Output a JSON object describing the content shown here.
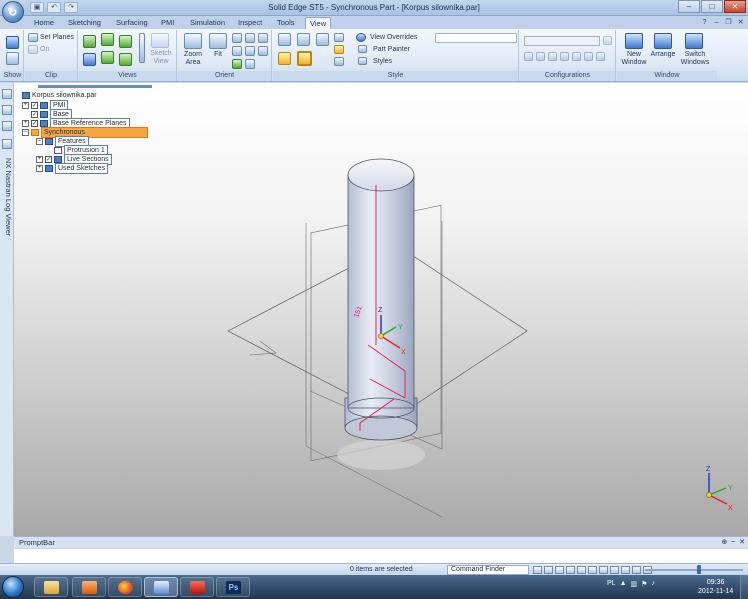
{
  "app": {
    "window_title": "Solid Edge ST5 - Synchronous Part - [Korpus silownika.par]",
    "quick_access": [
      "save-icon",
      "undo-icon",
      "redo-icon"
    ]
  },
  "tabs": [
    {
      "label": "Home",
      "active": false
    },
    {
      "label": "Sketching",
      "active": false
    },
    {
      "label": "Surfacing",
      "active": false
    },
    {
      "label": "PMI",
      "active": false
    },
    {
      "label": "Simulation",
      "active": false
    },
    {
      "label": "Inspect",
      "active": false
    },
    {
      "label": "Tools",
      "active": false
    },
    {
      "label": "View",
      "active": true
    }
  ],
  "ribbon": {
    "show": {
      "label": "Show"
    },
    "clip": {
      "label": "Clip",
      "set_planes": "Set Planes",
      "on": "On"
    },
    "views": {
      "label": "Views",
      "sketch_view": "Sketch\nView"
    },
    "orient": {
      "label": "Orient",
      "zoom_area": "Zoom\nArea",
      "fit": "Fit"
    },
    "style": {
      "label": "Style",
      "view_overrides": "View Overrides",
      "part_painter": "Part Painter",
      "styles": "Styles"
    },
    "configurations": {
      "label": "Configurations"
    },
    "window": {
      "label": "Window",
      "new_window": "New\nWindow",
      "arrange": "Arrange",
      "switch_windows": "Switch\nWindows"
    }
  },
  "sidebar": {
    "log_viewer": "NX Nastran Log Viewer"
  },
  "pathfinder": {
    "root": "Korpus silownika.par",
    "items": [
      {
        "label": "PMI",
        "checked": true
      },
      {
        "label": "Base",
        "checked": true
      },
      {
        "label": "Base Reference Planes",
        "checked": true
      },
      {
        "label": "Synchronous"
      },
      {
        "label": "Features"
      },
      {
        "label": "Protrusion 1"
      },
      {
        "label": "Live Sections",
        "checked": true
      },
      {
        "label": "Used Sketches"
      }
    ]
  },
  "model": {
    "dim_label": "151",
    "triad_labels": {
      "x": "X",
      "y": "Y",
      "z": "Z"
    }
  },
  "promptbar": {
    "title": "PromptBar"
  },
  "status": {
    "selection_text": "0 items are selected",
    "command_finder": "Command Finder"
  },
  "taskbar": {
    "apps": [
      "explorer",
      "media-player",
      "firefox",
      "solid-edge",
      "acrobat",
      "photoshop"
    ],
    "language": "PL",
    "time": "09:36",
    "date": "2012-11-14"
  },
  "colors": {
    "accent": "#f5a640",
    "dimension": "#e8174d",
    "axis_x": "#e82020",
    "axis_y": "#1faa2a",
    "axis_z": "#1c2fd6"
  }
}
